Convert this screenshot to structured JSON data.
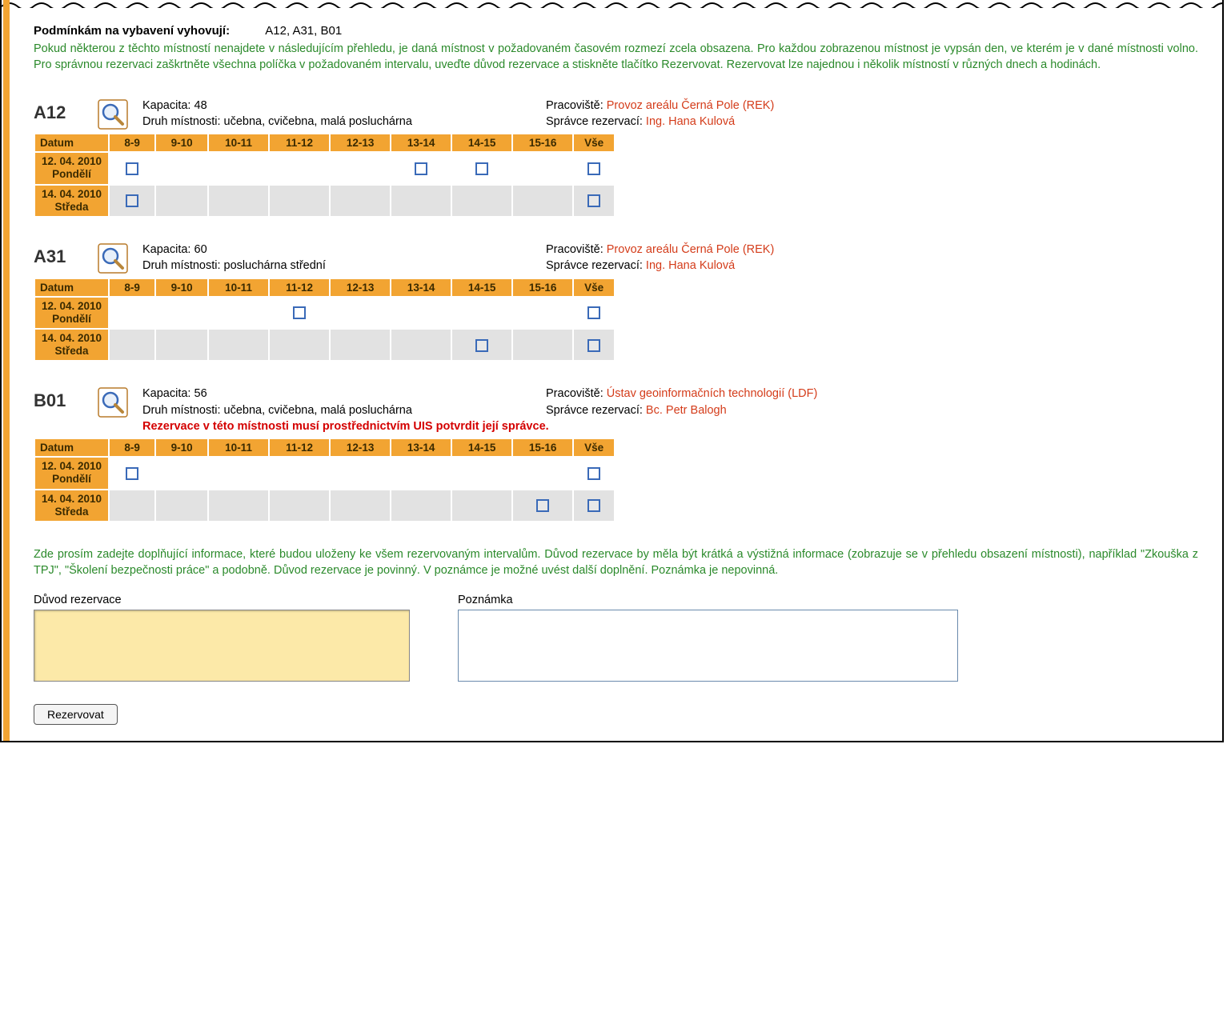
{
  "header": {
    "match_label": "Podmínkám na vybavení vyhovují:",
    "match_rooms": "A12, A31, B01",
    "intro": "Pokud některou z těchto místností nenajdete v následujícím přehledu, je daná místnost v požadovaném časovém rozmezí zcela obsazena. Pro každou zobrazenou místnost je vypsán den, ve kterém je v dané místnosti volno. Pro správnou rezervaci zaškrtněte všechna políčka v požadovaném intervalu, uveďte důvod rezervace a stiskněte tlačítko Rezervovat. Rezervovat lze najednou i několik místností v různých dnech a hodinách."
  },
  "labels": {
    "kapacita": "Kapacita:",
    "druh": "Druh místnosti:",
    "pracoviste": "Pracoviště:",
    "spravce": "Správce rezervací:",
    "datum": "Datum"
  },
  "time_headers": [
    "8-9",
    "9-10",
    "10-11",
    "11-12",
    "12-13",
    "13-14",
    "14-15",
    "15-16",
    "Vše"
  ],
  "rooms": [
    {
      "code": "A12",
      "kapacita": "48",
      "druh": "učebna, cvičebna, malá posluchárna",
      "pracoviste": "Provoz areálu Černá Pole (REK)",
      "spravce": "Ing. Hana Kulová",
      "warning": "",
      "rows": [
        {
          "date_line1": "12. 04. 2010",
          "date_line2": "Pondělí",
          "grey": false,
          "slots": [
            true,
            false,
            false,
            false,
            false,
            true,
            true,
            false,
            true
          ]
        },
        {
          "date_line1": "14. 04. 2010",
          "date_line2": "Středa",
          "grey": true,
          "slots": [
            true,
            false,
            false,
            false,
            false,
            false,
            false,
            false,
            true
          ]
        }
      ]
    },
    {
      "code": "A31",
      "kapacita": "60",
      "druh": "posluchárna střední",
      "pracoviste": "Provoz areálu Černá Pole (REK)",
      "spravce": "Ing. Hana Kulová",
      "warning": "",
      "rows": [
        {
          "date_line1": "12. 04. 2010",
          "date_line2": "Pondělí",
          "grey": false,
          "slots": [
            false,
            false,
            false,
            true,
            false,
            false,
            false,
            false,
            true
          ]
        },
        {
          "date_line1": "14. 04. 2010",
          "date_line2": "Středa",
          "grey": true,
          "slots": [
            false,
            false,
            false,
            false,
            false,
            false,
            true,
            false,
            true
          ]
        }
      ]
    },
    {
      "code": "B01",
      "kapacita": "56",
      "druh": "učebna, cvičebna, malá posluchárna",
      "pracoviste": "Ústav geoinformačních technologií (LDF)",
      "spravce": "Bc. Petr Balogh",
      "warning": "Rezervace v této místnosti musí prostřednictvím UIS potvrdit její správce.",
      "rows": [
        {
          "date_line1": "12. 04. 2010",
          "date_line2": "Pondělí",
          "grey": false,
          "slots": [
            true,
            false,
            false,
            false,
            false,
            false,
            false,
            false,
            true
          ]
        },
        {
          "date_line1": "14. 04. 2010",
          "date_line2": "Středa",
          "grey": true,
          "slots": [
            false,
            false,
            false,
            false,
            false,
            false,
            false,
            true,
            true
          ]
        }
      ]
    }
  ],
  "notes": {
    "instructions": "Zde prosím zadejte doplňující informace, které budou uloženy ke všem rezervovaným intervalům. Důvod rezervace by měla být krátká a výstižná informace (zobrazuje se v přehledu obsazení místnosti), například \"Zkouška z TPJ\", \"Školení bezpečnosti práce\" a podobně. Důvod rezervace je povinný. V poznámce je možné uvést další doplnění. Poznámka je nepovinná.",
    "reason_label": "Důvod rezervace",
    "note_label": "Poznámka",
    "reason_value": "",
    "note_value": ""
  },
  "buttons": {
    "reserve": "Rezervovat"
  }
}
